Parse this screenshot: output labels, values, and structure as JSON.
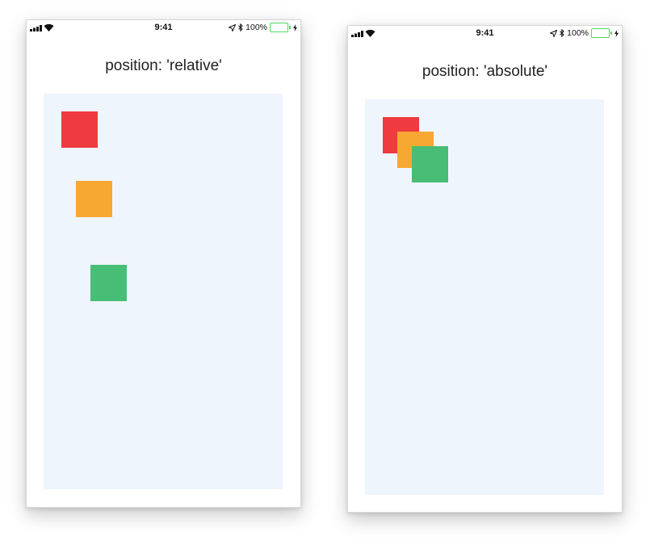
{
  "screens": [
    {
      "status": {
        "time": "9:41",
        "battery": "100%",
        "battery_level": 1.0
      },
      "title": "position: 'relative'",
      "boxes": [
        {
          "color": "#ef3a3f",
          "name": "red"
        },
        {
          "color": "#f7a833",
          "name": "orange"
        },
        {
          "color": "#48bd75",
          "name": "green"
        }
      ]
    },
    {
      "status": {
        "time": "9:41",
        "battery": "100%",
        "battery_level": 1.0
      },
      "title": "position: 'absolute'",
      "boxes": [
        {
          "color": "#ef3a3f",
          "name": "red"
        },
        {
          "color": "#f7a833",
          "name": "orange"
        },
        {
          "color": "#48bd75",
          "name": "green"
        }
      ]
    }
  ],
  "colors": {
    "canvas_background": "#eff5fd",
    "battery": "#4cd964"
  }
}
